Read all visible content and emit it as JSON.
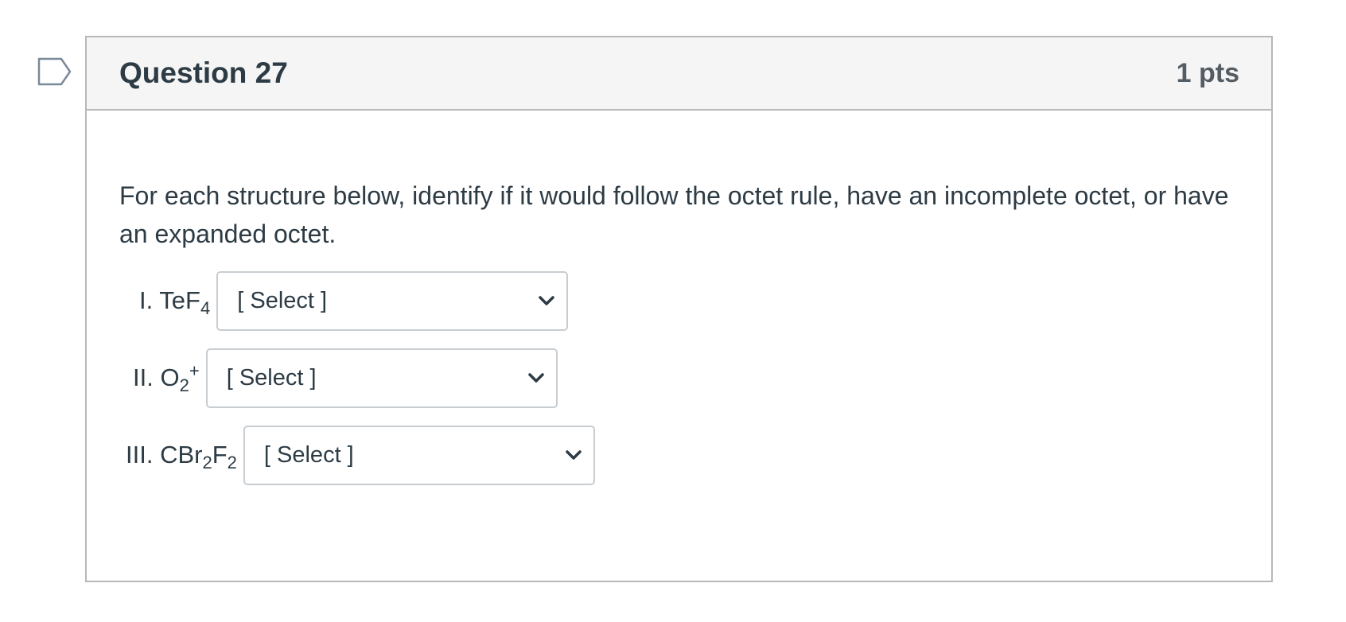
{
  "question": {
    "title": "Question 27",
    "points": "1 pts",
    "prompt": "For each structure below, identify if it would follow the octet rule, have an incomplete octet, or have an expanded octet.",
    "answers": [
      {
        "numeral": "I.",
        "formula_parts": [
          "TeF",
          "4"
        ],
        "selected": "[ Select ]"
      },
      {
        "numeral": "II.",
        "formula_parts": [
          "O",
          "2",
          "+"
        ],
        "selected": "[ Select ]"
      },
      {
        "numeral": "III.",
        "formula_parts": [
          "CBr",
          "2",
          "F",
          "2"
        ],
        "selected": "[ Select ]"
      }
    ]
  },
  "icons": {
    "flag": "flag-question-icon",
    "dropdown": "chevron-down-icon"
  },
  "colors": {
    "text": "#2d3b45",
    "header_bg": "#f5f5f5",
    "border": "#b8b8b8",
    "flag_stroke": "#7a8a99"
  }
}
